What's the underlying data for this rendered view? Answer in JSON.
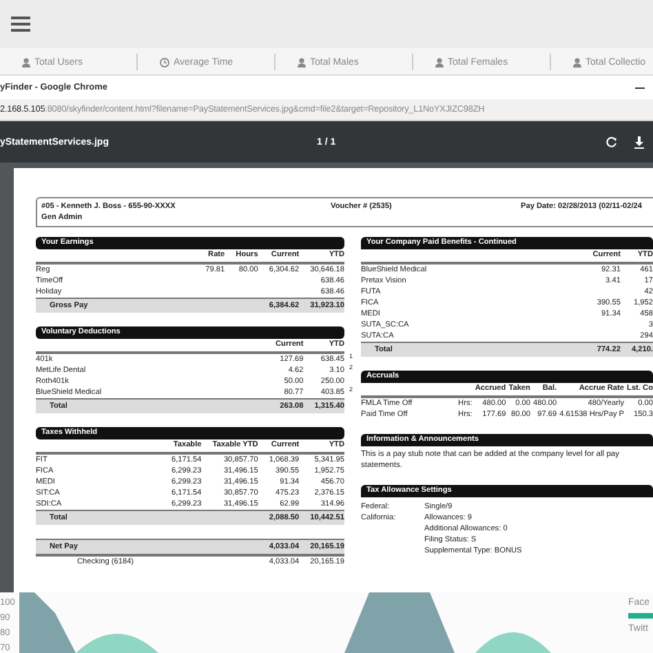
{
  "stats_tabs": [
    {
      "label": "Total Users",
      "kind": "user"
    },
    {
      "label": "Average Time",
      "kind": "clock"
    },
    {
      "label": "Total Males",
      "kind": "user"
    },
    {
      "label": "Total Females",
      "kind": "user"
    },
    {
      "label": "Total Collectio",
      "kind": "user"
    }
  ],
  "browser": {
    "title": "yFinder - Google Chrome",
    "url_host": "2.168.5.105",
    "url_rest": ":8080/skyfinder/content.html?filename=PayStatementServices.jpg&cmd=file2&target=Repository_L1NoYXJIZC98ZH"
  },
  "viewer": {
    "filename": "yStatementServices.jpg",
    "page": "1 / 1"
  },
  "document": {
    "header": {
      "employee": "#05 - Kenneth J. Boss - 655-90-XXXX",
      "department": "Gen Admin",
      "voucher": "Voucher # (2535)",
      "pay_date": "Pay Date: 02/28/2013 (02/11-02/24"
    },
    "left_sections": [
      {
        "kind": "table",
        "title": "Your Earnings",
        "columns": [
          "",
          "Rate",
          "Hours",
          "Current",
          "YTD"
        ],
        "rows": [
          {
            "kind": "line",
            "cells": [
              "Reg",
              "79.81",
              "80.00",
              "6,304.62",
              "30,646.18"
            ]
          },
          {
            "kind": "line",
            "cells": [
              "TimeOff",
              "",
              "",
              "",
              "638.46"
            ]
          },
          {
            "kind": "line",
            "cells": [
              "Holiday",
              "",
              "",
              "",
              "638.46"
            ]
          },
          {
            "kind": "total",
            "cells": [
              "Gross Pay",
              "",
              "",
              "6,384.62",
              "31,923.10"
            ]
          }
        ]
      },
      {
        "kind": "table",
        "title": "Voluntary Deductions",
        "columns": [
          "",
          "Current",
          "YTD"
        ],
        "rows": [
          {
            "kind": "line",
            "cells": [
              "401k",
              "127.69",
              "638.45"
            ],
            "note": "1"
          },
          {
            "kind": "line",
            "cells": [
              "MetLife Dental",
              "4.62",
              "3.10"
            ],
            "note": "2"
          },
          {
            "kind": "line",
            "cells": [
              "Roth401k",
              "50.00",
              "250.00"
            ]
          },
          {
            "kind": "line",
            "cells": [
              "BlueShield Medical",
              "80.77",
              "403.85"
            ],
            "note": "2"
          },
          {
            "kind": "total",
            "cells": [
              "Total",
              "263.08",
              "1,315.40"
            ]
          }
        ]
      },
      {
        "kind": "table",
        "title": "Taxes Withheld",
        "columns": [
          "",
          "Taxable",
          "Taxable YTD",
          "Current",
          "YTD"
        ],
        "rows": [
          {
            "kind": "line",
            "cells": [
              "FIT",
              "6,171.54",
              "30,857.70",
              "1,068.39",
              "5,341.95"
            ]
          },
          {
            "kind": "line",
            "cells": [
              "FICA",
              "6,299.23",
              "31,496.15",
              "390.55",
              "1,952.75"
            ]
          },
          {
            "kind": "line",
            "cells": [
              "MEDI",
              "6,299.23",
              "31,496.15",
              "91.34",
              "456.70"
            ]
          },
          {
            "kind": "line",
            "cells": [
              "SIT:CA",
              "6,171.54",
              "30,857.70",
              "475.23",
              "2,376.15"
            ]
          },
          {
            "kind": "line",
            "cells": [
              "SDI:CA",
              "6,299.23",
              "31,496.15",
              "62.99",
              "314.96"
            ]
          },
          {
            "kind": "total",
            "cells": [
              "Total",
              "",
              "",
              "2,088.50",
              "10,442.51"
            ]
          }
        ]
      },
      {
        "kind": "table",
        "rows": [
          {
            "kind": "total",
            "cells": [
              "Net Pay",
              "",
              "",
              "4,033.04",
              "20,165.19"
            ]
          },
          {
            "kind": "detail",
            "cells": [
              "Checking (6184)",
              "",
              "",
              "4,033.04",
              "20,165.19"
            ]
          }
        ]
      }
    ],
    "right_sections": [
      {
        "kind": "table",
        "title": "Your Company Paid Benefits - Continued",
        "columns": [
          "",
          "Current",
          "YTD"
        ],
        "rows": [
          {
            "kind": "line",
            "cells": [
              "BlueShield Medical",
              "92.31",
              "461"
            ]
          },
          {
            "kind": "line",
            "cells": [
              "Pretax Vision",
              "3.41",
              "17"
            ]
          },
          {
            "kind": "line",
            "cells": [
              "FUTA",
              "",
              "42"
            ]
          },
          {
            "kind": "line",
            "cells": [
              "FICA",
              "390.55",
              "1,952"
            ]
          },
          {
            "kind": "line",
            "cells": [
              "MEDI",
              "91.34",
              "458"
            ]
          },
          {
            "kind": "line",
            "cells": [
              "SUTA_SC:CA",
              "",
              "3"
            ]
          },
          {
            "kind": "line",
            "cells": [
              "SUTA:CA",
              "",
              "294"
            ]
          },
          {
            "kind": "total",
            "cells": [
              "Total",
              "774.22",
              "4,210."
            ]
          }
        ]
      },
      {
        "kind": "table",
        "title": "Accruals",
        "columns": [
          "",
          "",
          "Accrued",
          "Taken",
          "Bal.",
          "Accrue Rate",
          "Lst. Co"
        ],
        "rows": [
          {
            "kind": "line",
            "cells": [
              "FMLA Time Off",
              "Hrs:",
              "480.00",
              "0.00",
              "480.00",
              "480/Yearly",
              "0.00"
            ]
          },
          {
            "kind": "line",
            "cells": [
              "Paid Time Off",
              "Hrs:",
              "177.69",
              "80.00",
              "97.69",
              "4.61538 Hrs/Pay P",
              "150.3"
            ]
          }
        ]
      },
      {
        "kind": "note",
        "title": "Information & Announcements",
        "text": "This is a pay stub note that can be added at the company level for all pay statements."
      },
      {
        "kind": "pairs",
        "title": "Tax Allowance Settings",
        "items": [
          {
            "label": "Federal:",
            "values": [
              "Single/9"
            ]
          },
          {
            "label": "California:",
            "values": [
              "Allowances: 9",
              "Additional Allowances: 0",
              "Filing Status: S",
              "Supplemental Type: BONUS"
            ]
          }
        ]
      }
    ]
  },
  "dashboard": {
    "y_axis_labels": [
      "100",
      "90",
      "80",
      "70"
    ],
    "legend": [
      "Face",
      "Twitt"
    ]
  }
}
